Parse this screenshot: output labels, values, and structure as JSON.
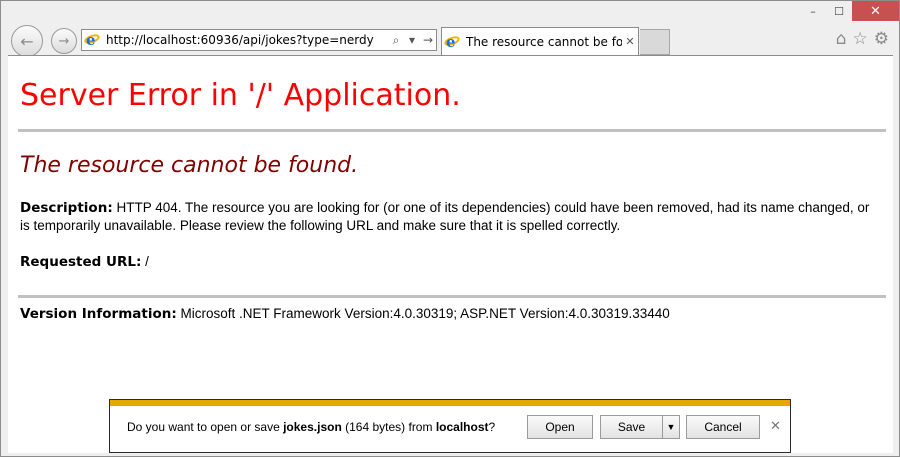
{
  "window": {
    "controls": {
      "minimize": "–",
      "maximize": "☐",
      "close": "✕"
    }
  },
  "toolbar": {
    "back_icon": "←",
    "forward_icon": "→",
    "address_url": "http://localhost:60936/api/jokes?type=nerdy",
    "search_icon": "⌕",
    "dropdown_icon": "▾",
    "go_icon": "→",
    "home_icon": "⌂",
    "favorites_icon": "☆",
    "settings_icon": "⚙"
  },
  "tab": {
    "title": "The resource cannot be fou...",
    "close_icon": "✕"
  },
  "page": {
    "heading": "Server Error in '/' Application.",
    "subheading": "The resource cannot be found.",
    "description_label": "Description:",
    "description_text": "HTTP 404. The resource you are looking for (or one of its dependencies) could have been removed, had its name changed, or is temporarily unavailable.  Please review the following URL and make sure that it is spelled correctly.",
    "requested_url_label": "Requested URL:",
    "requested_url_value": "/",
    "version_label": "Version Information:",
    "version_text": "Microsoft .NET Framework Version:4.0.30319; ASP.NET Version:4.0.30319.33440"
  },
  "download_bar": {
    "prefix": "Do you want to open or save ",
    "filename": "jokes.json",
    "size": " (164 bytes) from ",
    "host": "localhost",
    "suffix": "?",
    "open_label": "Open",
    "save_label": "Save",
    "save_dropdown_icon": "▼",
    "cancel_label": "Cancel",
    "close_icon": "✕",
    "accent_color": "#e6a700"
  }
}
